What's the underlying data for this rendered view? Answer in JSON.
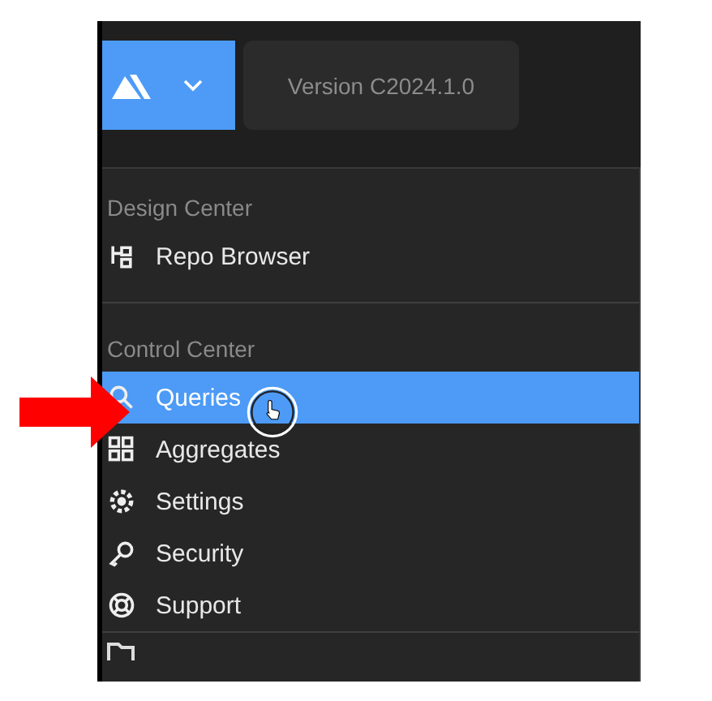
{
  "header": {
    "version": "Version C2024.1.0"
  },
  "sections": [
    {
      "title": "Design Center",
      "items": [
        {
          "label": "Repo Browser",
          "kind": "branch",
          "selected": false
        }
      ]
    },
    {
      "title": "Control Center",
      "items": [
        {
          "label": "Queries",
          "kind": "search",
          "selected": true
        },
        {
          "label": "Aggregates",
          "kind": "grid",
          "selected": false
        },
        {
          "label": "Settings",
          "kind": "gear",
          "selected": false
        },
        {
          "label": "Security",
          "kind": "key",
          "selected": false
        },
        {
          "label": "Support",
          "kind": "lifebuoy",
          "selected": false
        }
      ]
    }
  ]
}
